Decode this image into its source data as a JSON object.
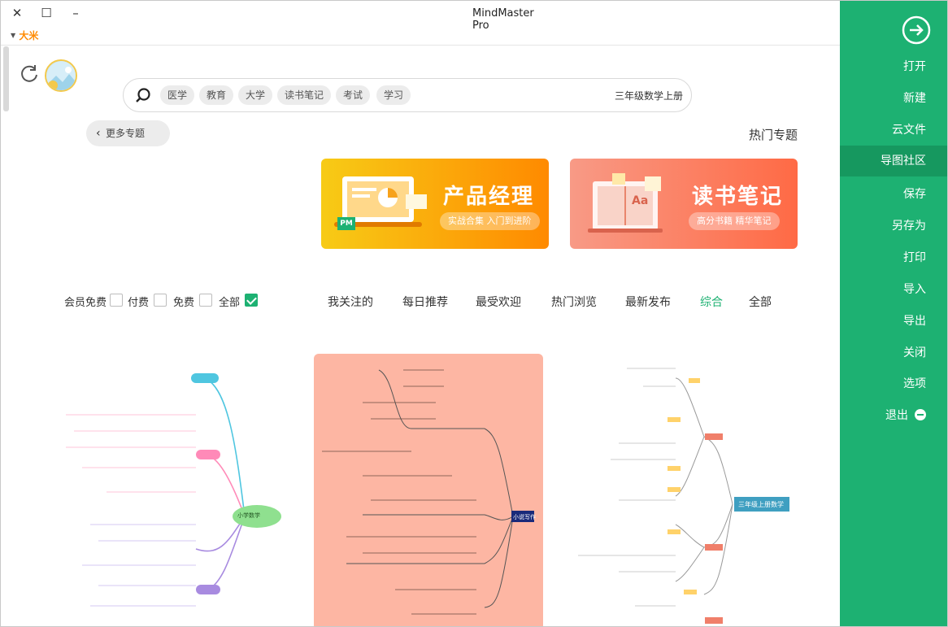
{
  "window": {
    "title": "MindMaster Pro",
    "close_glyph": "✕",
    "maximize_glyph": "☐",
    "minimize_glyph": "–"
  },
  "user": {
    "name": "大米"
  },
  "sidebar": {
    "items": [
      {
        "label": "打开"
      },
      {
        "label": "新建"
      },
      {
        "label": "云文件"
      },
      {
        "label": "导图社区"
      },
      {
        "label": "保存"
      },
      {
        "label": "另存为"
      },
      {
        "label": "打印"
      },
      {
        "label": "导入"
      },
      {
        "label": "导出"
      },
      {
        "label": "关闭"
      },
      {
        "label": "选项"
      },
      {
        "label": "退出"
      }
    ],
    "active_index": 3
  },
  "search": {
    "value": "三年级数学上册",
    "tags": [
      "学习",
      "考试",
      "读书笔记",
      "大学",
      "教育",
      "医学"
    ]
  },
  "more_topics": {
    "label": "更多专题"
  },
  "hot_topics": {
    "title": "热门专题"
  },
  "banners": [
    {
      "title": "读书笔记",
      "subtitle": "高分书籍 精华笔记",
      "badge": "Aa",
      "colors": [
        "#f89a86",
        "#ff6a45"
      ]
    },
    {
      "title": "产品经理",
      "subtitle": "实战合集 入门到进阶",
      "badge": "PM",
      "colors": [
        "#f7cb16",
        "#ff8a00"
      ]
    }
  ],
  "categories": [
    "全部",
    "综合",
    "最新发布",
    "热门浏览",
    "最受欢迎",
    "每日推荐",
    "我关注的"
  ],
  "active_category": "综合",
  "filters": [
    {
      "label": "全部",
      "checked": true
    },
    {
      "label": "免费",
      "checked": false
    },
    {
      "label": "付费",
      "checked": false
    },
    {
      "label": "会员免费",
      "checked": false
    }
  ],
  "cards": [
    {
      "root": "三年级上册数学",
      "root_color": "#3f9fc1"
    },
    {
      "root": "小说写作",
      "root_color": "#1a2a7a"
    },
    {
      "root": "小学数学",
      "root_color": "#8fe08f"
    }
  ],
  "colors": {
    "accent": "#1db172",
    "accent_dark": "#16985f",
    "user": "#ff8a00"
  },
  "icons": {
    "sidebar_top": "arrow-right-circle-icon",
    "refresh": "refresh-icon",
    "search": "search-icon",
    "exit": "minus-circle-icon"
  }
}
